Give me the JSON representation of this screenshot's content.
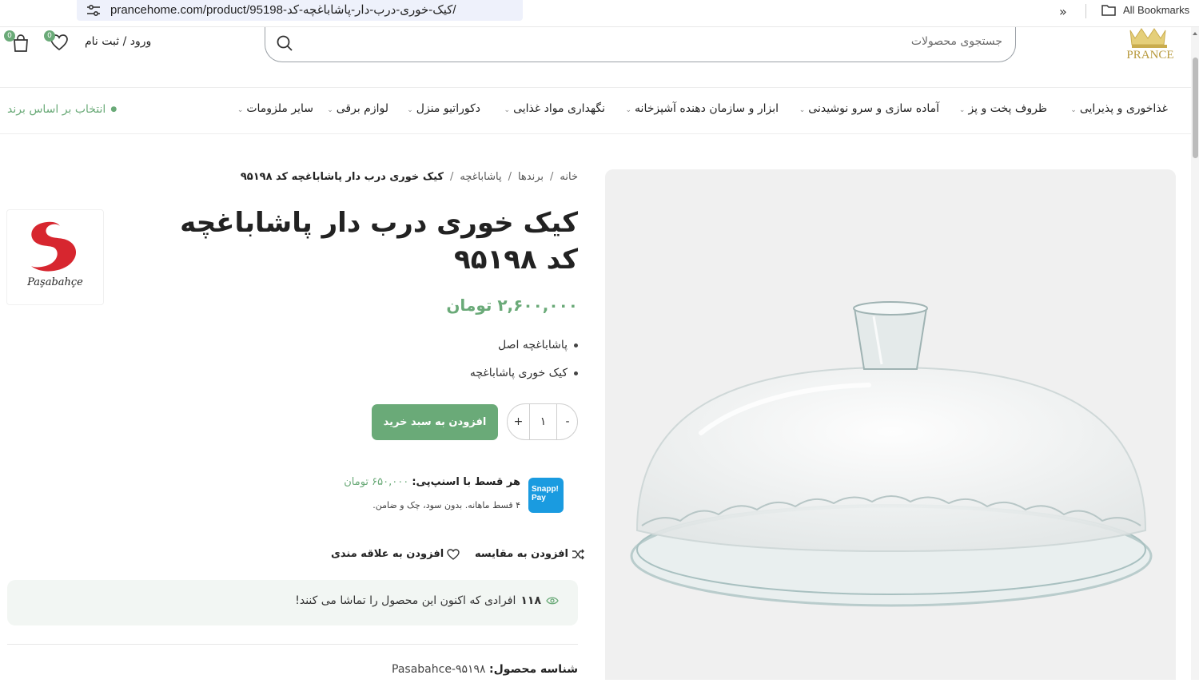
{
  "browser": {
    "url": "prancehome.com/product/95198-کیک-خوری-درب-دار-پاشاباغچه-کد/",
    "bookmarks_label": "All Bookmarks"
  },
  "header": {
    "logo_text": "PRANCE",
    "search_placeholder": "جستجوی محصولات",
    "login_label": "ورود / ثبت نام",
    "wishlist_count": "0",
    "cart_count": "0"
  },
  "nav": {
    "items": [
      "غذاخوری و پذیرایی",
      "ظروف پخت و پز",
      "آماده سازی و سرو نوشیدنی",
      "ابزار و سازمان دهنده آشپزخانه",
      "نگهداری مواد غذایی",
      "دکوراتیو منزل",
      "لوازم برقی",
      "سایر ملزومات"
    ],
    "brand_select": "انتخاب بر اساس برند"
  },
  "breadcrumb": {
    "home": "خانه",
    "brands": "برندها",
    "brand": "پاشاباغچه",
    "current": "کیک خوری درب دار پاشاباغچه کد ۹۵۱۹۸"
  },
  "product": {
    "title": "کیک خوری درب دار پاشاباغچه کد ۹۵۱۹۸",
    "price": "۲,۶۰۰,۰۰۰ تومان",
    "features": [
      "پاشاباغچه اصل",
      "کیک خوری پاشاباغچه"
    ],
    "quantity": "۱",
    "qty_minus": "-",
    "qty_plus": "+",
    "add_to_cart": "افزودن به سبد خرید",
    "brand_logo_text": "Paşabahçe",
    "sku_label": "شناسه محصول:",
    "sku_value": "Pasabahce-۹۵۱۹۸"
  },
  "snapp": {
    "logo_text": "Snapp! Pay",
    "line1_label": "هر قسط با اسنپ‌پی:",
    "line1_amount": "۶۵۰,۰۰۰ تومان",
    "line2": "۴ قسط ماهانه. بدون سود، چک و ضامن."
  },
  "actions": {
    "compare": "افزودن به مقایسه",
    "wishlist": "افزودن به علاقه مندی"
  },
  "viewers": {
    "count": "۱۱۸",
    "text": "افرادی که اکنون این محصول را تماشا می کنند!"
  },
  "colors": {
    "accent": "#6aaa78",
    "snapp_blue": "#1a9be0",
    "pasabahce_red": "#d7262f"
  }
}
